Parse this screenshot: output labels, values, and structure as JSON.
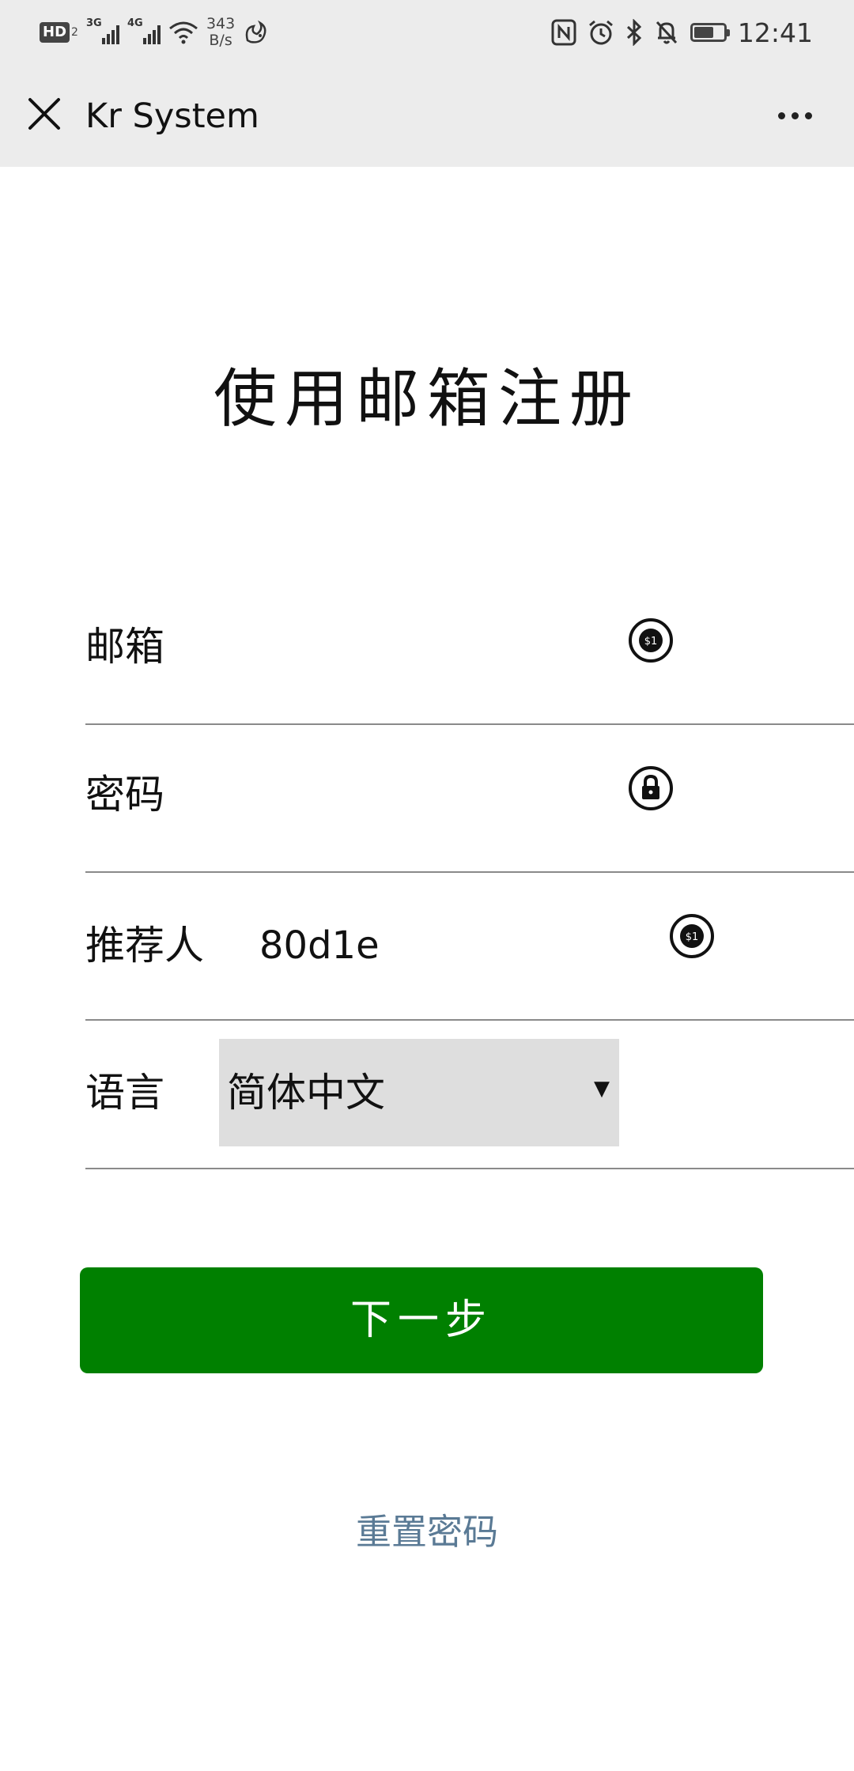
{
  "status_bar": {
    "hd_label": "HD",
    "hd_sub": "2",
    "net_3g": "3G",
    "net_4g": "4G",
    "speed_value": "343",
    "speed_unit": "B/s",
    "time": "12:41"
  },
  "title_bar": {
    "title": "Kr System"
  },
  "heading": "使用邮箱注册",
  "form": {
    "email_label": "邮箱",
    "password_label": "密码",
    "referrer_label": "推荐人",
    "referrer_value": "80d1e",
    "language_label": "语言",
    "language_selected": "简体中文",
    "caret": "▼"
  },
  "next_button": "下一步",
  "reset_link": "重置密码",
  "colors": {
    "primary_button": "#008000",
    "link": "#5a7a95",
    "bar_background": "#ececec"
  }
}
